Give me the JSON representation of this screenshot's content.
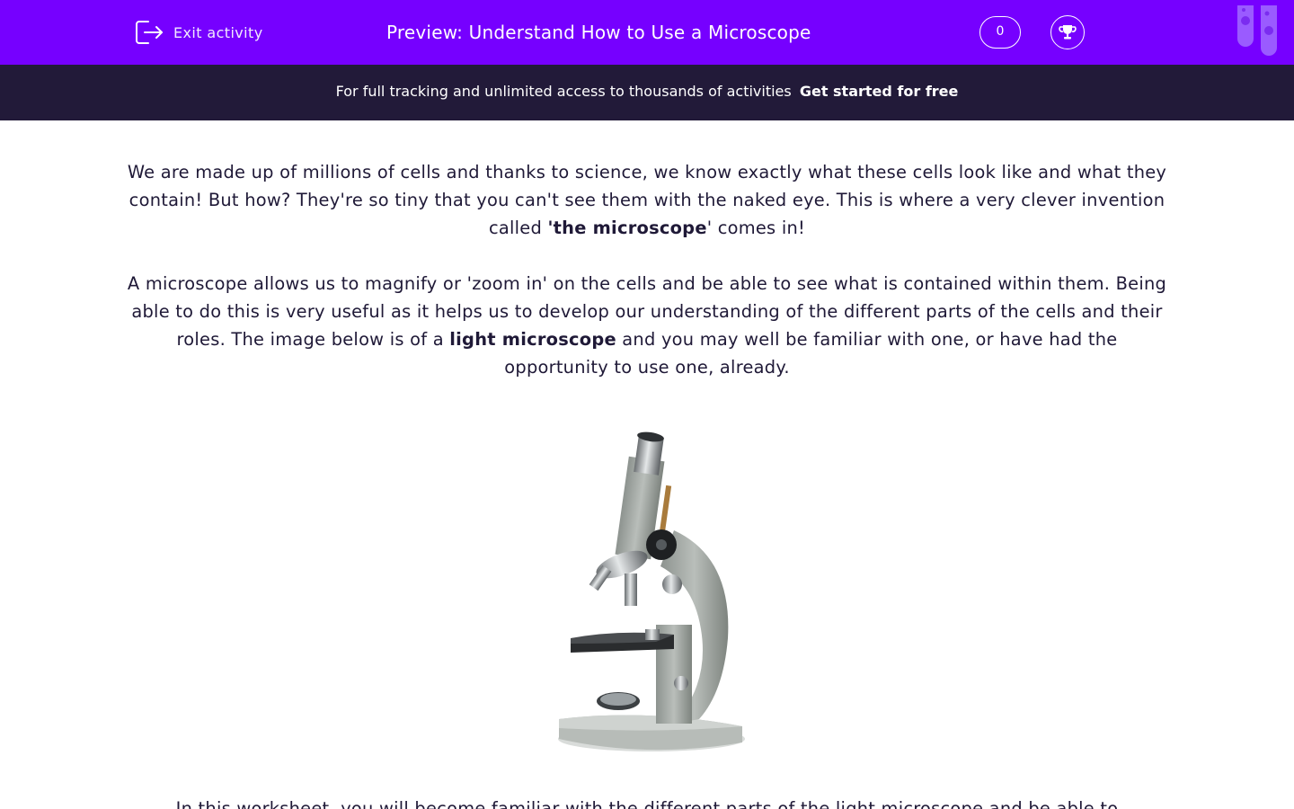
{
  "header": {
    "exit_label": "Exit activity",
    "title": "Preview: Understand How to Use a Microscope",
    "score": "0",
    "accent_color": "#7600ff"
  },
  "banner": {
    "text": "For full tracking and unlimited access to thousands of activities",
    "cta": "Get started for free",
    "background": "#221a39"
  },
  "intro": {
    "p1_before": "We are made up of millions of cells and thanks to science, we know exactly what these cells look like and what they contain! But how? They're so tiny that you can't see them with the naked eye. This is where a very clever invention called ",
    "p1_bold": "'the microscope",
    "p1_after": "' comes in!",
    "p2_before": "A microscope allows us to magnify or 'zoom in' on the cells and be able to see what is contained within them. Being able to do this is very useful as it helps us to develop our understanding of the different parts of the cells and their roles. The image below is of a ",
    "p2_bold": "light microscope",
    "p2_after": " and you may well be familiar with one, or have had the opportunity to use one, already.",
    "p3_partial": "In this worksheet, you will become familiar with the different parts of the light microscope and be able to"
  },
  "icons": {
    "exit": "exit-icon",
    "trophy": "trophy-icon",
    "logo": "test-tubes-logo"
  }
}
